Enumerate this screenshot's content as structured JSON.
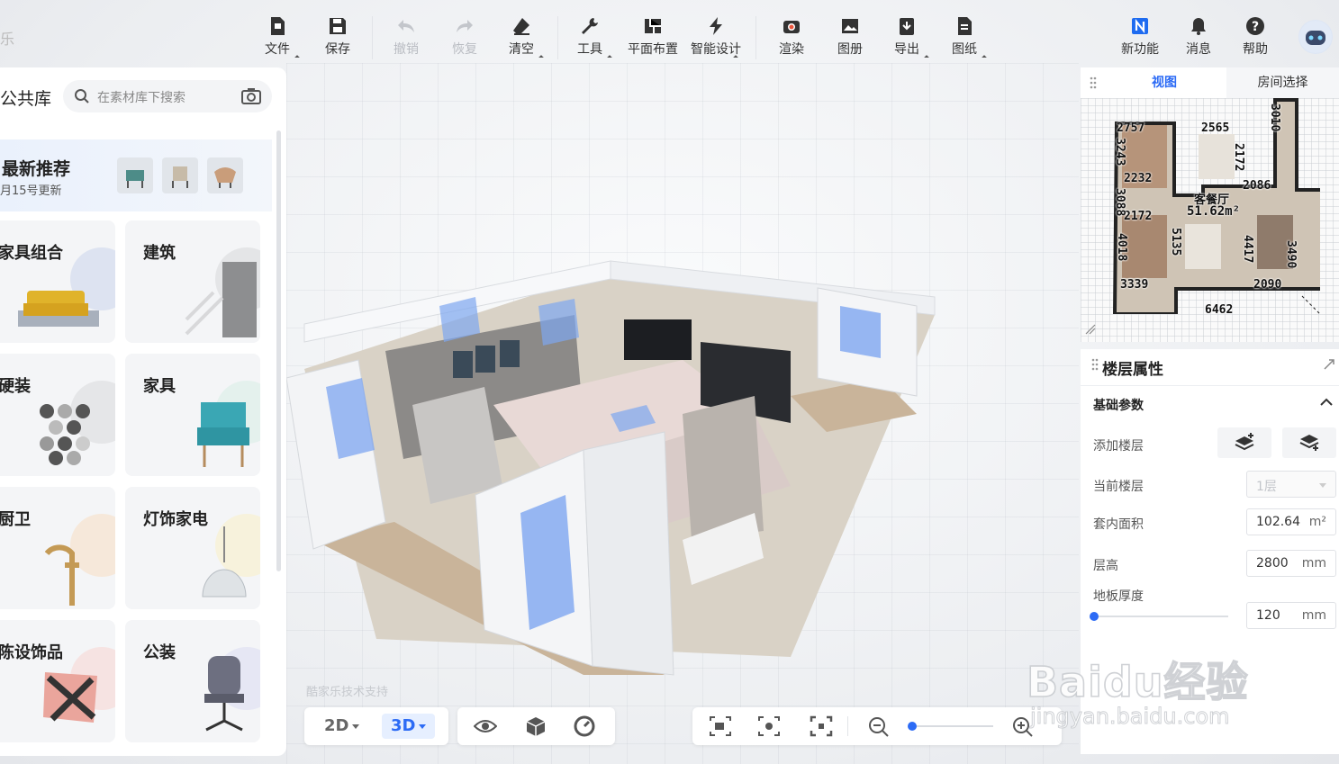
{
  "brand_stub": "乐",
  "toolbar": {
    "file": "文件",
    "save": "保存",
    "undo": "撤销",
    "redo": "恢复",
    "clear": "清空",
    "tools": "工具",
    "floor_layout": "平面布置",
    "smart_design": "智能设计",
    "render": "渲染",
    "album": "图册",
    "export": "导出",
    "drawings": "图纸",
    "new_features": "新功能",
    "messages": "消息",
    "help": "帮助"
  },
  "left_panel": {
    "title": "公共库",
    "search_placeholder": "在素材库下搜索",
    "recommend": {
      "title": "最新推荐",
      "subtitle": "月15号更新"
    },
    "categories": [
      {
        "label": "家具组合"
      },
      {
        "label": "建筑"
      },
      {
        "label": "硬装"
      },
      {
        "label": "家具"
      },
      {
        "label": "厨卫"
      },
      {
        "label": "灯饰家电"
      },
      {
        "label": "陈设饰品"
      },
      {
        "label": "公装"
      }
    ]
  },
  "canvas": {
    "credit": "酷家乐技术支持"
  },
  "bottom_bar": {
    "view_2d": "2D",
    "view_3d": "3D"
  },
  "right_panel": {
    "tabs": [
      "视图",
      "房间选择"
    ],
    "minimap": {
      "room_name": "客餐厅",
      "room_area": "51.62m²",
      "dims": [
        "2757",
        "2565",
        "3010",
        "3243",
        "2232",
        "2172",
        "2086",
        "2172",
        "2232",
        "3088",
        "4018",
        "5135",
        "4417",
        "3490",
        "3339",
        "2090",
        "6462"
      ]
    },
    "props": {
      "title": "楼层属性",
      "section": "基础参数",
      "add_floor": "添加楼层",
      "current_floor": "当前楼层",
      "current_floor_value": "1层",
      "inner_area": "套内面积",
      "inner_area_value": "102.64",
      "inner_area_unit": "m²",
      "floor_height": "层高",
      "floor_height_value": "2800",
      "floor_height_unit": "mm",
      "slab_thickness": "地板厚度",
      "slab_thickness_value": "120",
      "slab_thickness_unit": "mm"
    }
  },
  "watermark": {
    "logo": "Baidu经验",
    "url": "jingyan.baidu.com"
  },
  "colors": {
    "accent": "#2c6bf5",
    "panel": "#ffffff",
    "background": "#eef0f3"
  }
}
